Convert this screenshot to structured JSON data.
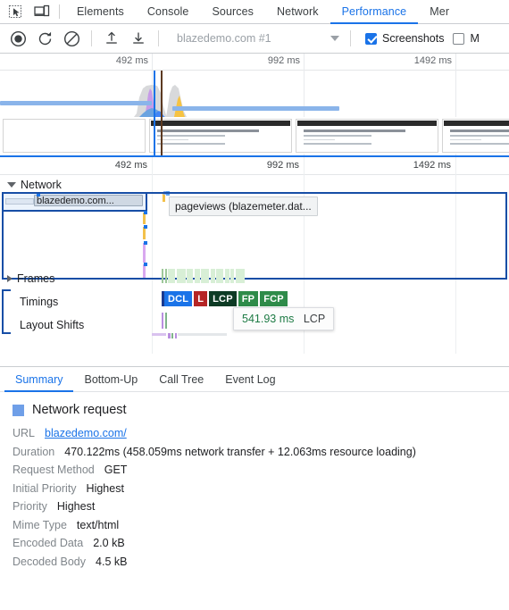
{
  "devtools": {
    "left_icons": [
      {
        "name": "inspect-element-icon",
        "label": "Inspect element"
      },
      {
        "name": "device-toolbar-icon",
        "label": "Toggle device toolbar"
      }
    ],
    "tabs": [
      {
        "label": "Elements",
        "active": false
      },
      {
        "label": "Console",
        "active": false
      },
      {
        "label": "Sources",
        "active": false
      },
      {
        "label": "Network",
        "active": false
      },
      {
        "label": "Performance",
        "active": true
      },
      {
        "label": "Mer",
        "active": false
      }
    ]
  },
  "controls": {
    "record_label": "Record",
    "reload_label": "Record and reload",
    "clear_label": "Clear",
    "upload_label": "Load profile",
    "download_label": "Save profile",
    "trace_select_value": "blazedemo.com #1",
    "screenshots": {
      "label": "Screenshots",
      "checked": true
    },
    "memory": {
      "label": "M",
      "checked": false
    }
  },
  "overview": {
    "ruler_ticks": [
      "492 ms",
      "992 ms",
      "1492 ms"
    ],
    "thumbnails": [
      {
        "title": "",
        "blank": true
      },
      {
        "title": "Welcome to the Simple Travel Agency!",
        "line1": "Choose your departure city:",
        "line2": "Choose your destination city:",
        "blank": false
      },
      {
        "title": "Welcome to the Simple Travel Agency!",
        "line1": "Choose your departure city:",
        "line2": "Choose your destination city:",
        "blank": false
      },
      {
        "title": "Welcome to the Simple Travel Agency!",
        "line1": "Choose your departure city:",
        "line2": "Choose your destination city:",
        "blank": false
      }
    ]
  },
  "timeline": {
    "ruler_ticks": [
      "492 ms",
      "992 ms",
      "1492 ms"
    ],
    "tracks": [
      {
        "name": "Network",
        "label": "Network",
        "expanded": true
      },
      {
        "name": "Frames",
        "label": "Frames",
        "expanded": false
      },
      {
        "name": "Timings",
        "label": "Timings",
        "expanded": true
      },
      {
        "name": "Layout Shifts",
        "label": "Layout Shifts",
        "expanded": true
      }
    ],
    "network_request_chip": "blazedemo.com...",
    "network_tooltip": "pageviews (blazemeter.dat...",
    "timing_markers": [
      {
        "label": "DCL",
        "color": "#1a73e8"
      },
      {
        "label": "L",
        "color": "#b52525"
      },
      {
        "label": "LCP",
        "color": "#0d3b24"
      },
      {
        "label": "FP",
        "color": "#2e8b49"
      },
      {
        "label": "FCP",
        "color": "#2e8b49"
      }
    ],
    "marker_tooltip": {
      "time": "541.93 ms",
      "name": "LCP"
    }
  },
  "drawer": {
    "tabs": [
      {
        "label": "Summary",
        "active": true
      },
      {
        "label": "Bottom-Up",
        "active": false
      },
      {
        "label": "Call Tree",
        "active": false
      },
      {
        "label": "Event Log",
        "active": false
      }
    ],
    "details": {
      "heading": "Network request",
      "swatch_color": "#6f9fe8",
      "rows": [
        {
          "key": "URL",
          "value": "blazedemo.com/",
          "link": true
        },
        {
          "key": "Duration",
          "value": "470.122ms (458.059ms network transfer + 12.063ms resource loading)",
          "link": false
        },
        {
          "key": "Request Method",
          "value": "GET",
          "link": false
        },
        {
          "key": "Initial Priority",
          "value": "Highest",
          "link": false
        },
        {
          "key": "Priority",
          "value": "Highest",
          "link": false
        },
        {
          "key": "Mime Type",
          "value": "text/html",
          "link": false
        },
        {
          "key": "Encoded Data",
          "value": "2.0 kB",
          "link": false
        },
        {
          "key": "Decoded Body",
          "value": "4.5 kB",
          "link": false
        }
      ]
    }
  }
}
